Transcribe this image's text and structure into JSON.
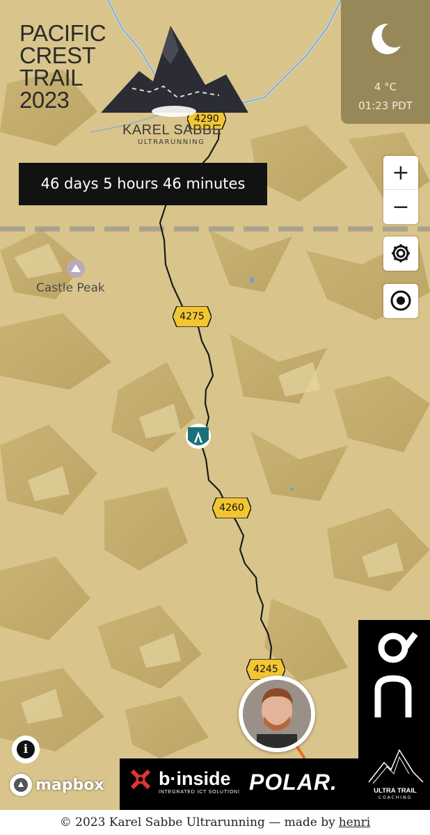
{
  "header": {
    "title_lines": [
      "PACIFIC",
      "CREST",
      "TRAIL",
      "2023"
    ],
    "logo_name": "KAREL SABBE",
    "logo_subtitle": "ULTRARUNNING"
  },
  "weather": {
    "icon": "moon-icon",
    "temperature": "4 °C",
    "time": "01:23 PDT"
  },
  "elapsed": "46 days 5 hours 46 minutes",
  "controls": {
    "zoom_in": "+",
    "zoom_out": "−",
    "settings_icon": "gear-icon",
    "locate_icon": "target-icon"
  },
  "map": {
    "place_name": "Castle Peak",
    "mile_markers": [
      "4290",
      "4275",
      "4260",
      "4245"
    ],
    "attribution": "mapbox",
    "info_label": "i",
    "colors": {
      "terrain": "#d9c58b",
      "route": "#1a1a1a",
      "marker": "#f2c632"
    }
  },
  "sponsors": {
    "binside_name": "b·inside",
    "binside_tagline": "INTEGRATED ICT SOLUTIONS",
    "polar": "POLAR.",
    "utc_name": "ULTRA TRAIL",
    "utc_sub": "COACHING",
    "on_brand": "On"
  },
  "footer": {
    "text": "© 2023 Karel Sabbe Ultrarunning — made by",
    "link": "henri"
  }
}
